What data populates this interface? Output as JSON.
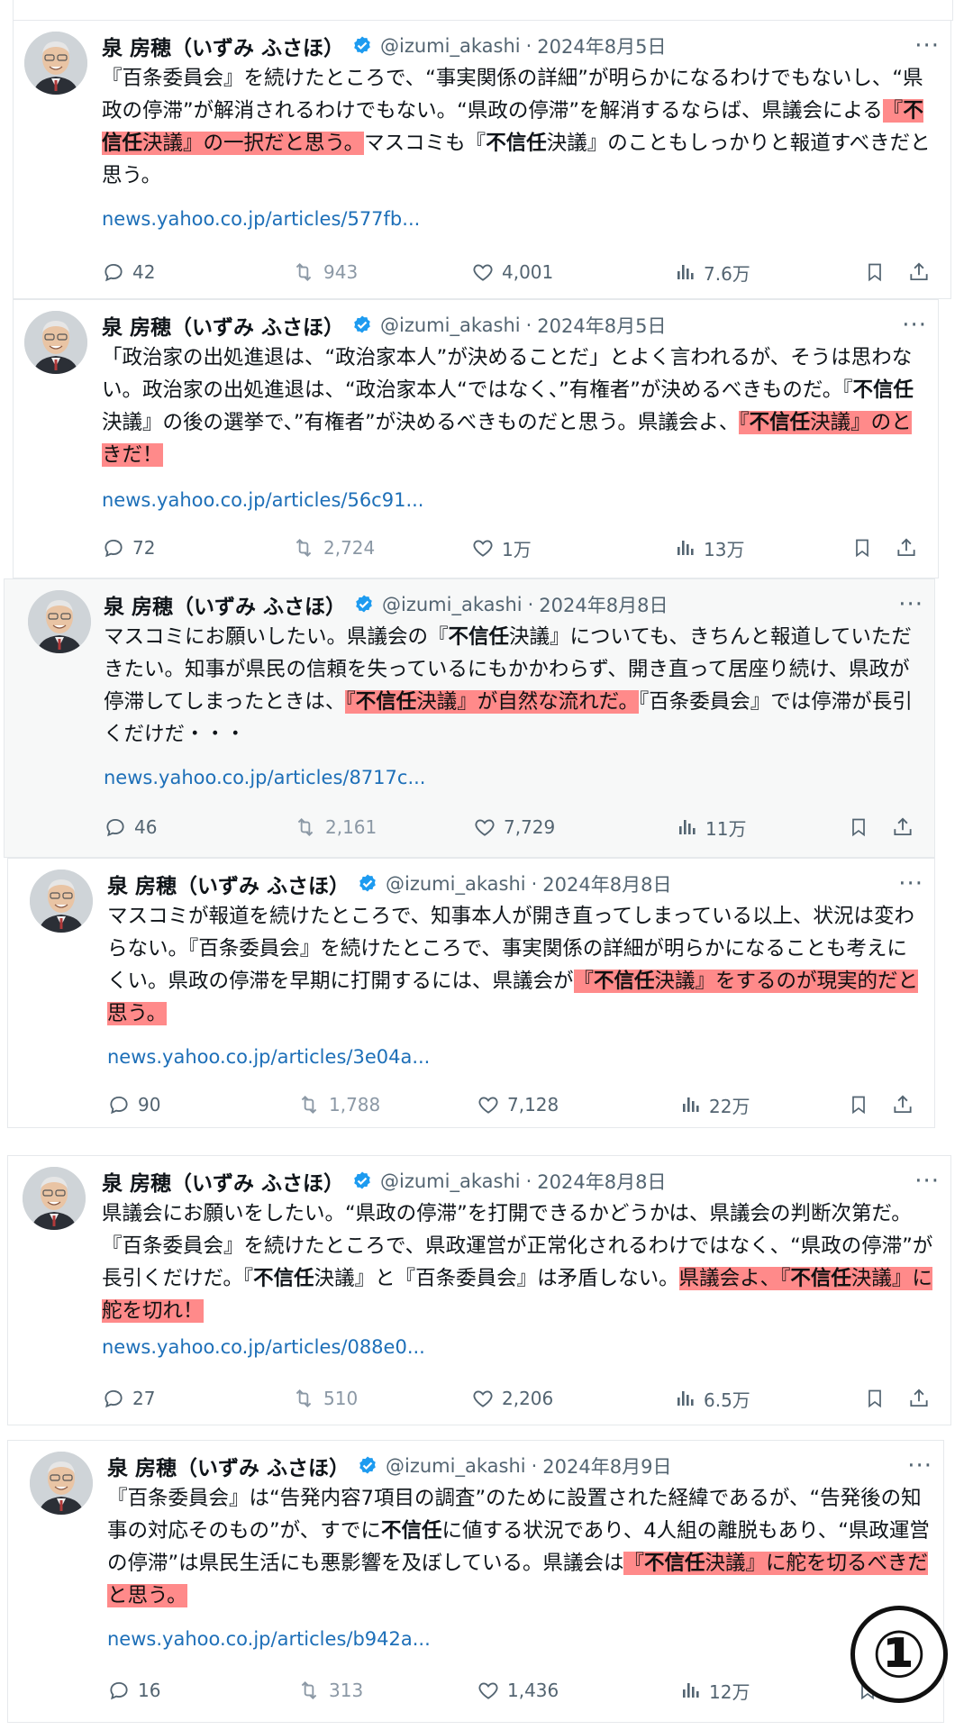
{
  "author": {
    "name": "泉 房穂（いずみ ふさほ）",
    "handle": "@izumi_akashi",
    "separator": "·"
  },
  "more_label": "···",
  "badge": "①",
  "colors": {
    "highlight": "#ff8a8a",
    "link": "#1d6fb8",
    "verified": "#1d9bf0",
    "muted": "#536471"
  },
  "tweets": [
    {
      "date": "2024年8月5日",
      "body": [
        {
          "t": "『百条委員会』を続けたところで、“事実関係の詳細”が明らかになるわけでもないし、“県政の停滞”が解消されるわけでもない。“県政の停滞”を解消するならば、県議会による"
        },
        {
          "t": "『",
          "hl": true
        },
        {
          "t": "不信任",
          "hl": true,
          "b": true
        },
        {
          "t": "決議』の一択だと思う。",
          "hl": true
        },
        {
          "t": "マスコミも『"
        },
        {
          "t": "不信任",
          "b": true
        },
        {
          "t": "決議』のこともしっかりと報道すべきだと思う。"
        }
      ],
      "link": "news.yahoo.co.jp/articles/577fb...",
      "replies": "42",
      "retweets": "943",
      "likes": "4,001",
      "views": "7.6万"
    },
    {
      "date": "2024年8月5日",
      "body": [
        {
          "t": "「政治家の出処進退は、“政治家本人”が決めることだ」とよく言われるが、そうは思わない。政治家の出処進退は、“政治家本人“ではなく、”有権者”が決めるべきものだ。『"
        },
        {
          "t": "不信任",
          "b": true
        },
        {
          "t": "決議』の後の選挙で、”有権者”が決めるべきものだと思う。県議会よ、"
        },
        {
          "t": "『",
          "hl": true
        },
        {
          "t": "不信任",
          "hl": true,
          "b": true
        },
        {
          "t": "決議』のときだ！",
          "hl": true
        }
      ],
      "link": "news.yahoo.co.jp/articles/56c91...",
      "replies": "72",
      "retweets": "2,724",
      "likes": "1万",
      "views": "13万"
    },
    {
      "date": "2024年8月8日",
      "body": [
        {
          "t": "マスコミにお願いしたい。県議会の『"
        },
        {
          "t": "不信任",
          "b": true
        },
        {
          "t": "決議』についても、きちんと報道していただきたい。知事が県民の信頼を失っているにもかかわらず、開き直って居座り続け、県政が停滞してしまったときは、"
        },
        {
          "t": "『",
          "hl": true
        },
        {
          "t": "不信任",
          "hl": true,
          "b": true
        },
        {
          "t": "決議』が自然な流れだ。",
          "hl": true
        },
        {
          "t": "『百条委員会』では停滞が長引くだけだ・・・"
        }
      ],
      "link": "news.yahoo.co.jp/articles/8717c...",
      "replies": "46",
      "retweets": "2,161",
      "likes": "7,729",
      "views": "11万"
    },
    {
      "date": "2024年8月8日",
      "body": [
        {
          "t": "マスコミが報道を続けたところで、知事本人が開き直ってしまっている以上、状況は変わらない。『百条委員会』を続けたところで、事実関係の詳細が明らかになることも考えにくい。県政の停滞を早期に打開するには、県議会が"
        },
        {
          "t": "『",
          "hl": true
        },
        {
          "t": "不信任",
          "hl": true,
          "b": true
        },
        {
          "t": "決議』をするのが現実的だと思う。",
          "hl": true
        }
      ],
      "link": "news.yahoo.co.jp/articles/3e04a...",
      "replies": "90",
      "retweets": "1,788",
      "likes": "7,128",
      "views": "22万"
    },
    {
      "date": "2024年8月8日",
      "body": [
        {
          "t": "県議会にお願いをしたい。“県政の停滞”を打開できるかどうかは、県議会の判断次第だ。『百条委員会』を続けたところで、県政運営が正常化されるわけではなく、“県政の停滞”が長引くだけだ。『"
        },
        {
          "t": "不信任",
          "b": true
        },
        {
          "t": "決議』と『百条委員会』は矛盾しない。"
        },
        {
          "t": "県議会よ、『",
          "hl": true
        },
        {
          "t": "不信任",
          "hl": true,
          "b": true
        },
        {
          "t": "決議』に舵を切れ！",
          "hl": true
        }
      ],
      "link": "news.yahoo.co.jp/articles/088e0...",
      "replies": "27",
      "retweets": "510",
      "likes": "2,206",
      "views": "6.5万"
    },
    {
      "date": "2024年8月9日",
      "body": [
        {
          "t": "『百条委員会』は“告発内容7項目の調査”のために設置された経緯であるが、“告発後の知事の対応そのもの”が、すでに"
        },
        {
          "t": "不信任",
          "b": true
        },
        {
          "t": "に値する状況であり、4人組の離脱もあり、“県政運営の停滞”は県民生活にも悪影響を及ぼしている。県議会は"
        },
        {
          "t": "『",
          "hl": true
        },
        {
          "t": "不信任",
          "hl": true,
          "b": true
        },
        {
          "t": "決議』に舵を切るべきだと思う。",
          "hl": true
        }
      ],
      "link": "news.yahoo.co.jp/articles/b942a...",
      "replies": "16",
      "retweets": "313",
      "likes": "1,436",
      "views": "12万"
    }
  ]
}
